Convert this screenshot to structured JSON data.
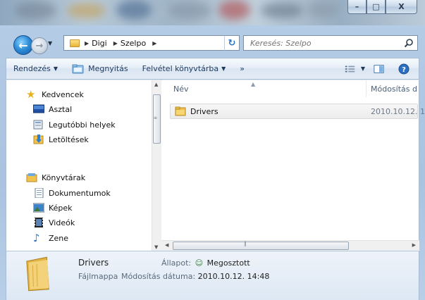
{
  "window": {
    "controls": {
      "minimize": "–",
      "maximize": "□",
      "close": "X"
    }
  },
  "navigation": {
    "back_icon": "arrow-left-icon",
    "forward_icon": "arrow-right-icon",
    "breadcrumb": [
      "Digi",
      "Szelpo"
    ],
    "search_placeholder": "Keresés: Szelpo"
  },
  "toolbar": {
    "organize": "Rendezés",
    "open": "Megnyitás",
    "library": "Felvétel könyvtárba",
    "more": "»"
  },
  "sidebar": {
    "favorites_header": "Kedvencek",
    "favorites": [
      "Asztal",
      "Legutóbbi helyek",
      "Letöltések"
    ],
    "libraries_header": "Könyvtárak",
    "libraries": [
      "Dokumentumok",
      "Képek",
      "Videók",
      "Zene"
    ]
  },
  "file_list": {
    "columns": [
      "Név",
      "Módosítás d"
    ],
    "rows": [
      {
        "name": "Drivers",
        "modified": "2010.10.12. 1"
      }
    ]
  },
  "details": {
    "name": "Drivers",
    "type": "Fájlmappa",
    "state_label": "Állapot:",
    "state_value": "Megosztott",
    "modified_label": "Módosítás dátuma:",
    "modified_value": "2010.10.12. 14:48"
  },
  "colors": {
    "chrome": "#b6cde6",
    "toolbar_text": "#1e395b",
    "search_text": "#6d6d6d"
  }
}
